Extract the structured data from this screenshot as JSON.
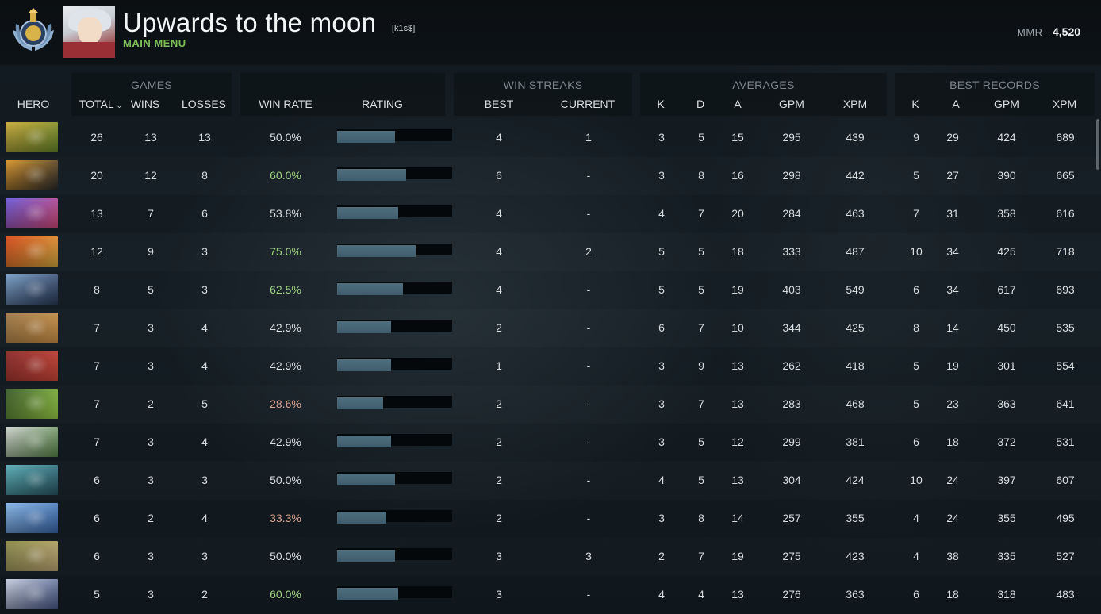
{
  "header": {
    "player_name": "Upwards to the moon",
    "player_tag": "[k1s$]",
    "main_menu_label": "MAIN MENU",
    "mmr_label": "MMR",
    "mmr_value": "4,520"
  },
  "groups": {
    "games": "GAMES",
    "win_streaks": "WIN STREAKS",
    "averages": "AVERAGES",
    "best_records": "BEST RECORDS"
  },
  "columns": {
    "hero": "HERO",
    "total": "TOTAL",
    "wins": "WINS",
    "losses": "LOSSES",
    "win_rate": "WIN RATE",
    "rating": "RATING",
    "best": "BEST",
    "current": "CURRENT",
    "avg_k": "K",
    "avg_d": "D",
    "avg_a": "A",
    "avg_gpm": "GPM",
    "avg_xpm": "XPM",
    "best_k": "K",
    "best_a": "A",
    "best_gpm": "GPM",
    "best_xpm": "XPM"
  },
  "colors": {
    "win_rate_good": "#9dd07c",
    "win_rate_neutral": "#d8dde0",
    "win_rate_bad": "#d9a08e",
    "rating_bar": "#4a6878",
    "main_menu": "#7fbf5a"
  },
  "rows": [
    {
      "hero_icon": "hero-portrait-yellow",
      "hero_colors": [
        "#c9a93a",
        "#6a8a2a"
      ],
      "total": "26",
      "wins": "13",
      "losses": "13",
      "win_rate": "50.0%",
      "wr_class": "neutral",
      "rating": 0.5,
      "best_streak": "4",
      "current_streak": "1",
      "avg_k": "3",
      "avg_d": "5",
      "avg_a": "15",
      "avg_gpm": "295",
      "avg_xpm": "439",
      "best_k": "9",
      "best_a": "29",
      "best_gpm": "424",
      "best_xpm": "689"
    },
    {
      "hero_icon": "hero-portrait-orange",
      "hero_colors": [
        "#d9952a",
        "#2a2a2a"
      ],
      "total": "20",
      "wins": "12",
      "losses": "8",
      "win_rate": "60.0%",
      "wr_class": "good",
      "rating": 0.6,
      "best_streak": "6",
      "current_streak": "-",
      "avg_k": "3",
      "avg_d": "8",
      "avg_a": "16",
      "avg_gpm": "298",
      "avg_xpm": "442",
      "best_k": "5",
      "best_a": "27",
      "best_gpm": "390",
      "best_xpm": "665"
    },
    {
      "hero_icon": "hero-portrait-purple",
      "hero_colors": [
        "#6a5ad9",
        "#d94a7a"
      ],
      "total": "13",
      "wins": "7",
      "losses": "6",
      "win_rate": "53.8%",
      "wr_class": "neutral",
      "rating": 0.53,
      "best_streak": "4",
      "current_streak": "-",
      "avg_k": "4",
      "avg_d": "7",
      "avg_a": "20",
      "avg_gpm": "284",
      "avg_xpm": "463",
      "best_k": "7",
      "best_a": "31",
      "best_gpm": "358",
      "best_xpm": "616"
    },
    {
      "hero_icon": "hero-portrait-red",
      "hero_colors": [
        "#d94a1a",
        "#e0b040"
      ],
      "total": "12",
      "wins": "9",
      "losses": "3",
      "win_rate": "75.0%",
      "wr_class": "good",
      "rating": 0.68,
      "best_streak": "4",
      "current_streak": "2",
      "avg_k": "5",
      "avg_d": "5",
      "avg_a": "18",
      "avg_gpm": "333",
      "avg_xpm": "487",
      "best_k": "10",
      "best_a": "34",
      "best_gpm": "425",
      "best_xpm": "718"
    },
    {
      "hero_icon": "hero-portrait-blue",
      "hero_colors": [
        "#7aa0c8",
        "#2a3a5a"
      ],
      "total": "8",
      "wins": "5",
      "losses": "3",
      "win_rate": "62.5%",
      "wr_class": "good",
      "rating": 0.57,
      "best_streak": "4",
      "current_streak": "-",
      "avg_k": "5",
      "avg_d": "5",
      "avg_a": "19",
      "avg_gpm": "403",
      "avg_xpm": "549",
      "best_k": "6",
      "best_a": "34",
      "best_gpm": "617",
      "best_xpm": "693"
    },
    {
      "hero_icon": "hero-portrait-brown",
      "hero_colors": [
        "#a07a4a",
        "#d99a4a"
      ],
      "total": "7",
      "wins": "3",
      "losses": "4",
      "win_rate": "42.9%",
      "wr_class": "neutral",
      "rating": 0.47,
      "best_streak": "2",
      "current_streak": "-",
      "avg_k": "6",
      "avg_d": "7",
      "avg_a": "10",
      "avg_gpm": "344",
      "avg_xpm": "425",
      "best_k": "8",
      "best_a": "14",
      "best_gpm": "450",
      "best_xpm": "535"
    },
    {
      "hero_icon": "hero-portrait-crimson",
      "hero_colors": [
        "#8a2a2a",
        "#d94a3a"
      ],
      "total": "7",
      "wins": "3",
      "losses": "4",
      "win_rate": "42.9%",
      "wr_class": "neutral",
      "rating": 0.47,
      "best_streak": "1",
      "current_streak": "-",
      "avg_k": "3",
      "avg_d": "9",
      "avg_a": "13",
      "avg_gpm": "262",
      "avg_xpm": "418",
      "best_k": "5",
      "best_a": "19",
      "best_gpm": "301",
      "best_xpm": "554"
    },
    {
      "hero_icon": "hero-portrait-green",
      "hero_colors": [
        "#3a5a2a",
        "#a0d94a"
      ],
      "total": "7",
      "wins": "2",
      "losses": "5",
      "win_rate": "28.6%",
      "wr_class": "bad",
      "rating": 0.4,
      "best_streak": "2",
      "current_streak": "-",
      "avg_k": "3",
      "avg_d": "7",
      "avg_a": "13",
      "avg_gpm": "283",
      "avg_xpm": "468",
      "best_k": "5",
      "best_a": "23",
      "best_gpm": "363",
      "best_xpm": "641"
    },
    {
      "hero_icon": "hero-portrait-grey",
      "hero_colors": [
        "#d0d4d0",
        "#5a8a4a"
      ],
      "total": "7",
      "wins": "3",
      "losses": "4",
      "win_rate": "42.9%",
      "wr_class": "neutral",
      "rating": 0.47,
      "best_streak": "2",
      "current_streak": "-",
      "avg_k": "3",
      "avg_d": "5",
      "avg_a": "12",
      "avg_gpm": "299",
      "avg_xpm": "381",
      "best_k": "6",
      "best_a": "18",
      "best_gpm": "372",
      "best_xpm": "531"
    },
    {
      "hero_icon": "hero-portrait-teal",
      "hero_colors": [
        "#5ab0b8",
        "#2a5a6a"
      ],
      "total": "6",
      "wins": "3",
      "losses": "3",
      "win_rate": "50.0%",
      "wr_class": "neutral",
      "rating": 0.5,
      "best_streak": "2",
      "current_streak": "-",
      "avg_k": "4",
      "avg_d": "5",
      "avg_a": "13",
      "avg_gpm": "304",
      "avg_xpm": "424",
      "best_k": "10",
      "best_a": "24",
      "best_gpm": "397",
      "best_xpm": "607"
    },
    {
      "hero_icon": "hero-portrait-ice",
      "hero_colors": [
        "#8ab8e8",
        "#3a6ab0"
      ],
      "total": "6",
      "wins": "2",
      "losses": "4",
      "win_rate": "33.3%",
      "wr_class": "bad",
      "rating": 0.43,
      "best_streak": "2",
      "current_streak": "-",
      "avg_k": "3",
      "avg_d": "8",
      "avg_a": "14",
      "avg_gpm": "257",
      "avg_xpm": "355",
      "best_k": "4",
      "best_a": "24",
      "best_gpm": "355",
      "best_xpm": "495"
    },
    {
      "hero_icon": "hero-portrait-olive",
      "hero_colors": [
        "#8a8a4a",
        "#c8b07a"
      ],
      "total": "6",
      "wins": "3",
      "losses": "3",
      "win_rate": "50.0%",
      "wr_class": "neutral",
      "rating": 0.5,
      "best_streak": "3",
      "current_streak": "3",
      "avg_k": "2",
      "avg_d": "7",
      "avg_a": "19",
      "avg_gpm": "275",
      "avg_xpm": "423",
      "best_k": "4",
      "best_a": "38",
      "best_gpm": "335",
      "best_xpm": "527"
    },
    {
      "hero_icon": "hero-portrait-pale",
      "hero_colors": [
        "#c8d0e0",
        "#4a5a8a"
      ],
      "total": "5",
      "wins": "3",
      "losses": "2",
      "win_rate": "60.0%",
      "wr_class": "good",
      "rating": 0.53,
      "best_streak": "3",
      "current_streak": "-",
      "avg_k": "4",
      "avg_d": "4",
      "avg_a": "13",
      "avg_gpm": "276",
      "avg_xpm": "363",
      "best_k": "6",
      "best_a": "18",
      "best_gpm": "318",
      "best_xpm": "483"
    }
  ]
}
